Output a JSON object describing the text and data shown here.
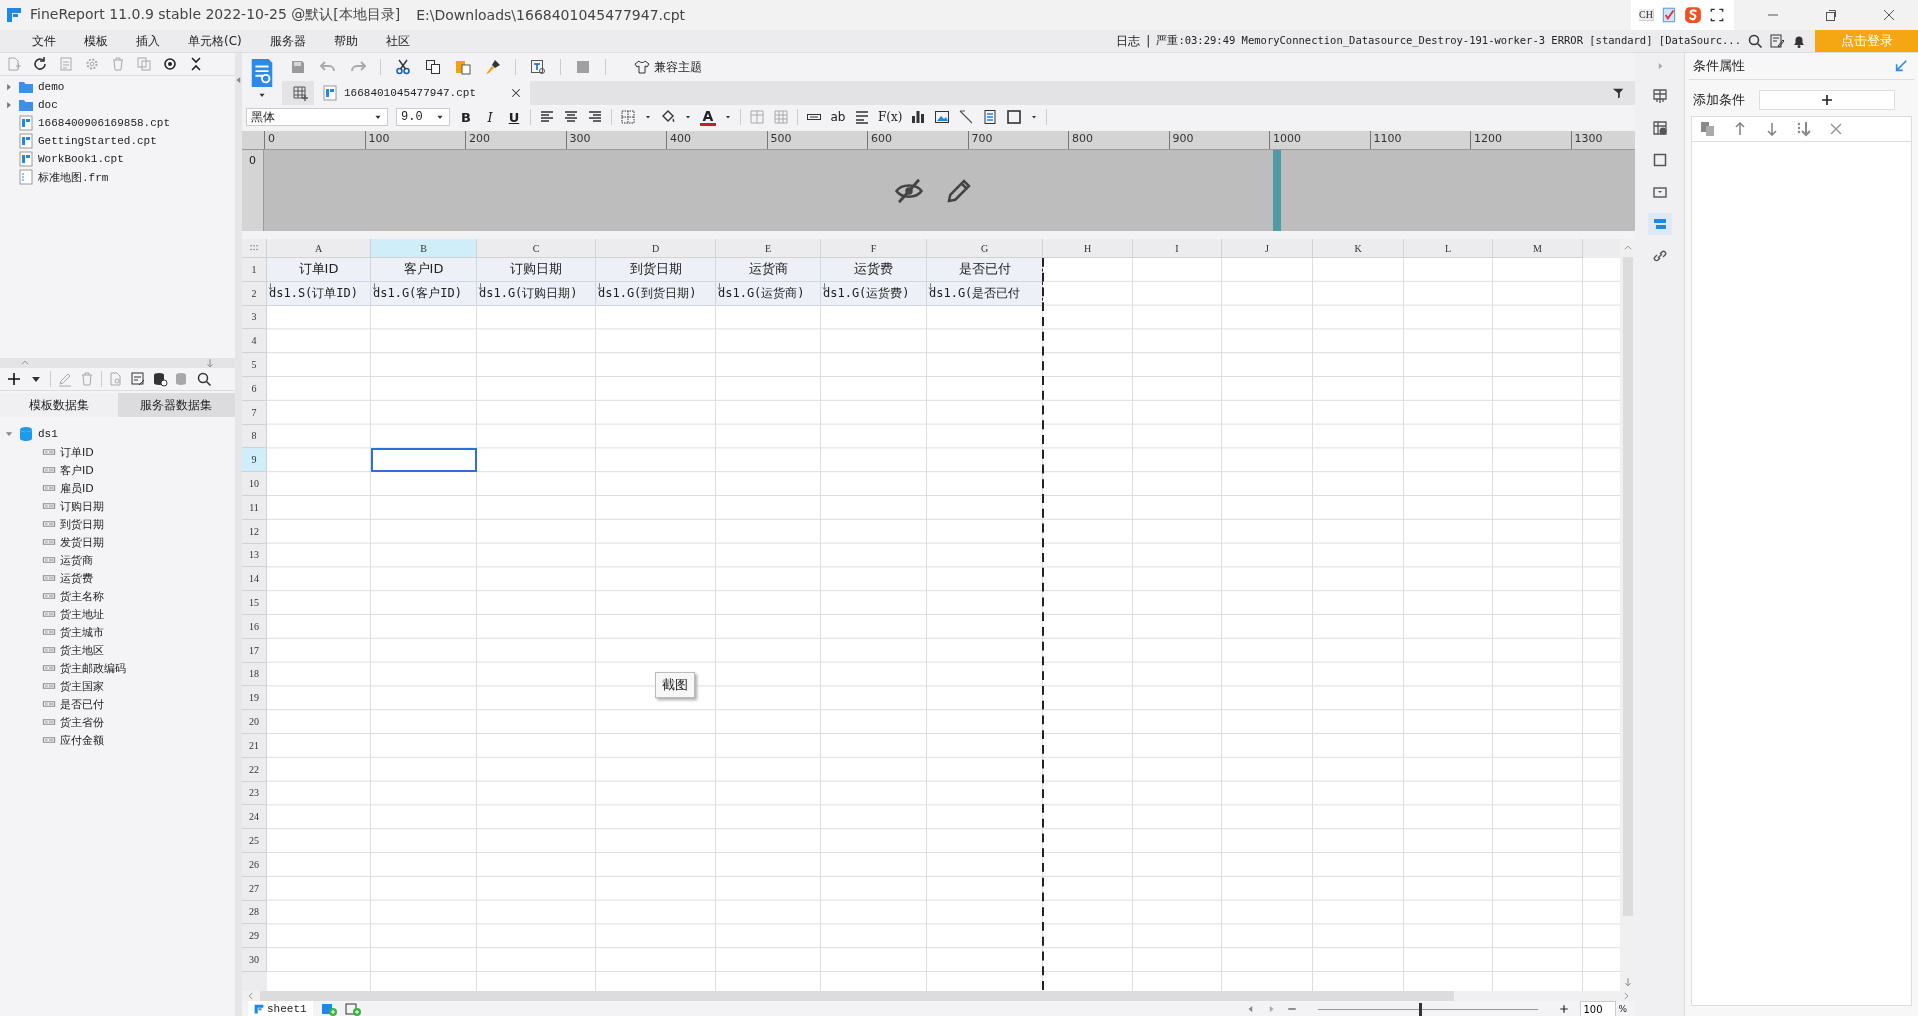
{
  "window": {
    "title": "FineReport 11.0.9 stable 2022-10-25 @默认[本地目录]",
    "path": "E:\\Downloads\\1668401045477947.cpt",
    "input_method": "CH"
  },
  "menu": [
    "文件",
    "模板",
    "插入",
    "单元格(C)",
    "服务器",
    "帮助",
    "社区"
  ],
  "log": {
    "label": "日志",
    "separator": "|",
    "message": "严重:03:29:49 MemoryConnection_Datasource_Destroy-191-worker-3 ERROR [standard] [DataSourc..."
  },
  "login_button": "点击登录",
  "file_tree": [
    {
      "name": "demo",
      "kind": "folder",
      "expanded": false
    },
    {
      "name": "doc",
      "kind": "folder",
      "expanded": false
    },
    {
      "name": "1668400906169858.cpt",
      "kind": "report"
    },
    {
      "name": "GettingStarted.cpt",
      "kind": "report"
    },
    {
      "name": "WorkBook1.cpt",
      "kind": "report"
    },
    {
      "name": "标准地图.frm",
      "kind": "form"
    }
  ],
  "dataset_tabs": [
    {
      "label": "模板数据集",
      "selected": true
    },
    {
      "label": "服务器数据集",
      "selected": false
    }
  ],
  "datasets": [
    {
      "name": "ds1",
      "expanded": true,
      "children": [
        {
          "name": "订单ID"
        },
        {
          "name": "客户ID"
        },
        {
          "name": "雇员ID"
        },
        {
          "name": "订购日期"
        },
        {
          "name": "到货日期"
        },
        {
          "name": "发货日期"
        },
        {
          "name": "运货商"
        },
        {
          "name": "运货费"
        },
        {
          "name": "货主名称"
        },
        {
          "name": "货主地址"
        },
        {
          "name": "货主城市"
        },
        {
          "name": "货主地区"
        },
        {
          "name": "货主邮政编码"
        },
        {
          "name": "货主国家"
        },
        {
          "name": "是否已付"
        },
        {
          "name": "货主省份"
        },
        {
          "name": "应付金额"
        }
      ]
    }
  ],
  "toolbar": {
    "theme_button": "兼容主题"
  },
  "document_tabs": [
    {
      "label": "1668401045477947.cpt",
      "selected": true
    }
  ],
  "format_bar": {
    "font": "黑体",
    "size": "9.0",
    "bold": "B",
    "italic": "I",
    "underline": "U",
    "font_color": "A",
    "text_type": "ab",
    "formula": "F(x)"
  },
  "ruler": {
    "ticks": [
      "0",
      "100",
      "200",
      "300",
      "400",
      "500",
      "600",
      "700",
      "800",
      "900",
      "1000",
      "1100",
      "1200",
      "1300"
    ],
    "vertical_tick": "0"
  },
  "sheet": {
    "columns": [
      {
        "label": "A",
        "selected": false,
        "page_break": false
      },
      {
        "label": "B",
        "selected": true,
        "page_break": false
      },
      {
        "label": "C",
        "selected": false,
        "page_break": false
      },
      {
        "label": "D",
        "selected": false,
        "page_break": false
      },
      {
        "label": "E",
        "selected": false,
        "page_break": false
      },
      {
        "label": "F",
        "selected": false,
        "page_break": false
      },
      {
        "label": "G",
        "selected": false,
        "page_break": true
      },
      {
        "label": "H",
        "selected": false,
        "page_break": false
      },
      {
        "label": "I",
        "selected": false,
        "page_break": false
      },
      {
        "label": "J",
        "selected": false,
        "page_break": false
      },
      {
        "label": "K",
        "selected": false,
        "page_break": false
      },
      {
        "label": "L",
        "selected": false,
        "page_break": false
      },
      {
        "label": "M",
        "selected": false,
        "page_break": false
      }
    ],
    "rows": [
      {
        "label": "1",
        "selected": false,
        "kind": "title",
        "cells": [
          "订单ID",
          "客户ID",
          "订购日期",
          "到货日期",
          "运货商",
          "运货费",
          "是否已付"
        ]
      },
      {
        "label": "2",
        "selected": false,
        "kind": "formula",
        "cells": [
          "ds1.S(订单ID)",
          "ds1.G(客户ID)",
          "ds1.G(订购日期)",
          "ds1.G(到货日期)",
          "ds1.G(运货商)",
          "ds1.G(运货费)",
          "ds1.G(是否已付"
        ]
      },
      {
        "label": "3",
        "selected": false,
        "kind": "blank"
      },
      {
        "label": "4",
        "selected": false,
        "kind": "blank"
      },
      {
        "label": "5",
        "selected": false,
        "kind": "blank"
      },
      {
        "label": "6",
        "selected": false,
        "kind": "blank"
      },
      {
        "label": "7",
        "selected": false,
        "kind": "blank"
      },
      {
        "label": "8",
        "selected": false,
        "kind": "blank"
      },
      {
        "label": "9",
        "selected": true,
        "kind": "blank"
      },
      {
        "label": "10",
        "selected": false,
        "kind": "blank"
      },
      {
        "label": "11",
        "selected": false,
        "kind": "blank"
      },
      {
        "label": "12",
        "selected": false,
        "kind": "blank"
      },
      {
        "label": "13",
        "selected": false,
        "kind": "blank"
      },
      {
        "label": "14",
        "selected": false,
        "kind": "blank"
      },
      {
        "label": "15",
        "selected": false,
        "kind": "blank"
      },
      {
        "label": "16",
        "selected": false,
        "kind": "blank"
      },
      {
        "label": "17",
        "selected": false,
        "kind": "blank"
      },
      {
        "label": "18",
        "selected": false,
        "kind": "blank"
      },
      {
        "label": "19",
        "selected": false,
        "kind": "blank"
      },
      {
        "label": "20",
        "selected": false,
        "kind": "blank"
      },
      {
        "label": "21",
        "selected": false,
        "kind": "blank"
      },
      {
        "label": "22",
        "selected": false,
        "kind": "blank"
      },
      {
        "label": "23",
        "selected": false,
        "kind": "blank"
      },
      {
        "label": "24",
        "selected": false,
        "kind": "blank"
      },
      {
        "label": "25",
        "selected": false,
        "kind": "blank"
      },
      {
        "label": "26",
        "selected": false,
        "kind": "blank"
      },
      {
        "label": "27",
        "selected": false,
        "kind": "blank"
      },
      {
        "label": "28",
        "selected": false,
        "kind": "blank"
      },
      {
        "label": "29",
        "selected": false,
        "kind": "blank"
      },
      {
        "label": "30",
        "selected": false,
        "kind": "blank"
      }
    ]
  },
  "screenshot_tooltip": "截图",
  "sheet_tabs": [
    {
      "label": "sheet1",
      "selected": true
    }
  ],
  "zoom": {
    "level": 0.46,
    "value": "100",
    "unit": "%"
  },
  "property_tabs": [
    {
      "selected": false
    },
    {
      "selected": false
    },
    {
      "selected": false
    },
    {
      "selected": false
    },
    {
      "selected": true
    },
    {
      "selected": false
    }
  ],
  "condition_panel": {
    "title": "条件属性",
    "add_label": "添加条件"
  }
}
